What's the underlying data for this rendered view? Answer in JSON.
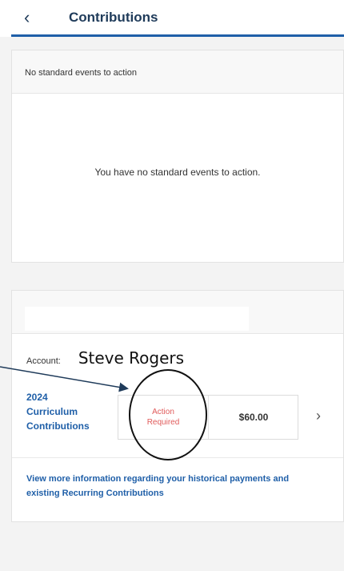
{
  "header": {
    "back_icon": "chevron-left-icon",
    "title": "Contributions"
  },
  "standard_events": {
    "header_text": "No standard events to action",
    "empty_message": "You have no standard events to action."
  },
  "account": {
    "label": "Account:",
    "name": "Steve Rogers"
  },
  "contribution": {
    "name_lines": [
      "2024",
      "Curriculum",
      "Contributions"
    ],
    "status_lines": [
      "Action",
      "Required"
    ],
    "amount": "$60.00"
  },
  "links": {
    "more_info": "View more information regarding your historical payments and existing Recurring Contributions"
  },
  "colors": {
    "brand": "#1f5fa8",
    "status": "#e05a5a",
    "annotation": "#1f3b5a"
  }
}
